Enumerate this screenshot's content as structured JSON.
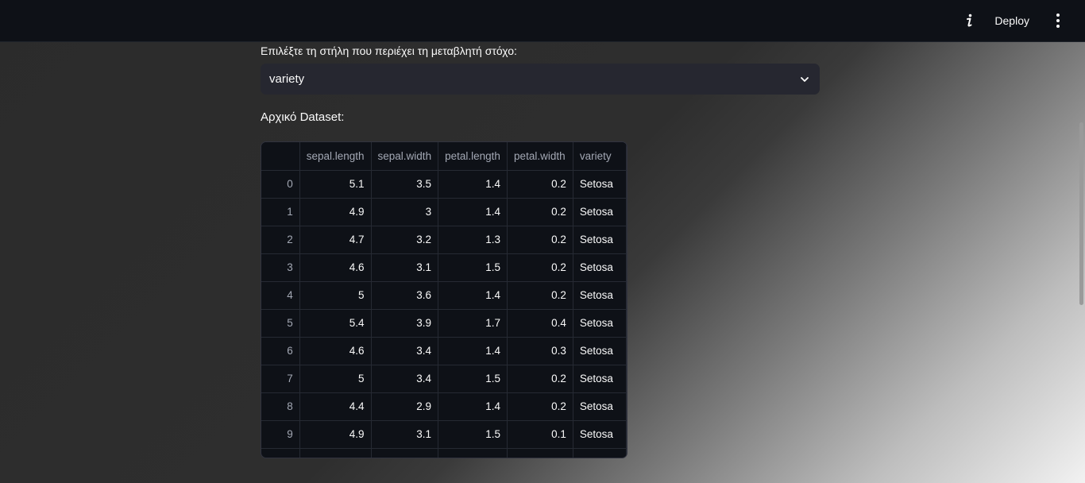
{
  "topbar": {
    "info_icon": "info-icon",
    "deploy_label": "Deploy",
    "menu_icon": "more-vertical-icon"
  },
  "target_select": {
    "label": "Επιλέξτε τη στήλη που περιέχει τη μεταβλητή στόχο:",
    "selected": "variety",
    "icon": "chevron-down-icon"
  },
  "dataset": {
    "title": "Αρχικό Dataset:",
    "columns": [
      "",
      "sepal.length",
      "sepal.width",
      "petal.length",
      "petal.width",
      "variety"
    ],
    "rows": [
      [
        "0",
        "5.1",
        "3.5",
        "1.4",
        "0.2",
        "Setosa"
      ],
      [
        "1",
        "4.9",
        "3",
        "1.4",
        "0.2",
        "Setosa"
      ],
      [
        "2",
        "4.7",
        "3.2",
        "1.3",
        "0.2",
        "Setosa"
      ],
      [
        "3",
        "4.6",
        "3.1",
        "1.5",
        "0.2",
        "Setosa"
      ],
      [
        "4",
        "5",
        "3.6",
        "1.4",
        "0.2",
        "Setosa"
      ],
      [
        "5",
        "5.4",
        "3.9",
        "1.7",
        "0.4",
        "Setosa"
      ],
      [
        "6",
        "4.6",
        "3.4",
        "1.4",
        "0.3",
        "Setosa"
      ],
      [
        "7",
        "5",
        "3.4",
        "1.5",
        "0.2",
        "Setosa"
      ],
      [
        "8",
        "4.4",
        "2.9",
        "1.4",
        "0.2",
        "Setosa"
      ],
      [
        "9",
        "4.9",
        "3.1",
        "1.5",
        "0.1",
        "Setosa"
      ]
    ]
  }
}
